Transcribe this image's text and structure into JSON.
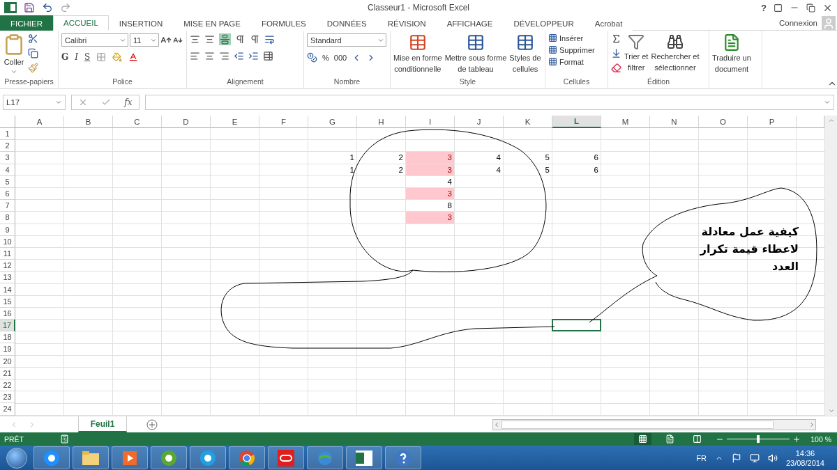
{
  "title_bar": {
    "title": "Classeur1 - Microsoft Excel",
    "help": "?"
  },
  "ribbon_tabs": [
    {
      "label": "FICHIER",
      "kind": "file",
      "selected": false
    },
    {
      "label": "ACCUEIL",
      "kind": "tab",
      "selected": true
    },
    {
      "label": "INSERTION",
      "kind": "tab",
      "selected": false
    },
    {
      "label": "MISE EN PAGE",
      "kind": "tab",
      "selected": false
    },
    {
      "label": "FORMULES",
      "kind": "tab",
      "selected": false
    },
    {
      "label": "DONNÉES",
      "kind": "tab",
      "selected": false
    },
    {
      "label": "RÉVISION",
      "kind": "tab",
      "selected": false
    },
    {
      "label": "AFFICHAGE",
      "kind": "tab",
      "selected": false
    },
    {
      "label": "DÉVELOPPEUR",
      "kind": "tab",
      "selected": false
    },
    {
      "label": "Acrobat",
      "kind": "tab",
      "selected": false
    }
  ],
  "account": "Connexion",
  "ribbon": {
    "clipboard": {
      "title": "Presse-papiers",
      "paste": "Coller"
    },
    "font": {
      "title": "Police",
      "font_name": "Calibri",
      "font_size": "11",
      "bold": "G",
      "italic": "I",
      "underline": "S"
    },
    "alignment": {
      "title": "Alignement"
    },
    "number": {
      "title": "Nombre",
      "format": "Standard",
      "percent": "%",
      "thousands": "000"
    },
    "style": {
      "title": "Style",
      "buttons": [
        {
          "lines": [
            "Mise en forme",
            "conditionnelle"
          ]
        },
        {
          "lines": [
            "Mettre sous forme",
            "de tableau"
          ]
        },
        {
          "lines": [
            "Styles de",
            "cellules"
          ]
        }
      ]
    },
    "cells": {
      "title": "Cellules",
      "buttons": [
        "Insérer",
        "Supprimer",
        "Format"
      ]
    },
    "editing": {
      "title": "Édition",
      "buttons": [
        {
          "lines": [
            "Trier et",
            "filtrer"
          ]
        },
        {
          "lines": [
            "Rechercher et",
            "sélectionner"
          ]
        }
      ]
    },
    "acrobat": {
      "buttons": [
        {
          "lines": [
            "Traduire un",
            "document"
          ]
        }
      ]
    }
  },
  "formula_bar": {
    "name_box": "L17",
    "function_label": "fx"
  },
  "sheet": {
    "columns": [
      {
        "label": "A",
        "selected": false
      },
      {
        "label": "B",
        "selected": false
      },
      {
        "label": "C",
        "selected": false
      },
      {
        "label": "D",
        "selected": false
      },
      {
        "label": "E",
        "selected": false
      },
      {
        "label": "F",
        "selected": false
      },
      {
        "label": "G",
        "selected": false
      },
      {
        "label": "H",
        "selected": false
      },
      {
        "label": "I",
        "selected": false
      },
      {
        "label": "J",
        "selected": false
      },
      {
        "label": "K",
        "selected": false
      },
      {
        "label": "L",
        "selected": true
      },
      {
        "label": "M",
        "selected": false
      },
      {
        "label": "N",
        "selected": false
      },
      {
        "label": "O",
        "selected": false
      },
      {
        "label": "P",
        "selected": false
      }
    ],
    "rows": [
      {
        "label": "1",
        "selected": false
      },
      {
        "label": "2",
        "selected": false
      },
      {
        "label": "3",
        "selected": false,
        "cells": {
          "G": {
            "value": "1",
            "highlight": false,
            "selected": false
          },
          "H": {
            "value": "2",
            "highlight": false,
            "selected": false
          },
          "I": {
            "value": "3",
            "highlight": true,
            "selected": false
          },
          "J": {
            "value": "4",
            "highlight": false,
            "selected": false
          },
          "K": {
            "value": "5",
            "highlight": false,
            "selected": false
          },
          "L": {
            "value": "6",
            "highlight": false,
            "selected": false
          }
        }
      },
      {
        "label": "4",
        "selected": false,
        "cells": {
          "G": {
            "value": "1",
            "highlight": false,
            "selected": false
          },
          "H": {
            "value": "2",
            "highlight": false,
            "selected": false
          },
          "I": {
            "value": "3",
            "highlight": true,
            "selected": false
          },
          "J": {
            "value": "4",
            "highlight": false,
            "selected": false
          },
          "K": {
            "value": "5",
            "highlight": false,
            "selected": false
          },
          "L": {
            "value": "6",
            "highlight": false,
            "selected": false
          }
        }
      },
      {
        "label": "5",
        "selected": false,
        "cells": {
          "I": {
            "value": "4",
            "highlight": false,
            "selected": false
          }
        }
      },
      {
        "label": "6",
        "selected": false,
        "cells": {
          "I": {
            "value": "3",
            "highlight": true,
            "selected": false
          }
        }
      },
      {
        "label": "7",
        "selected": false,
        "cells": {
          "I": {
            "value": "8",
            "highlight": false,
            "selected": false
          }
        }
      },
      {
        "label": "8",
        "selected": false,
        "cells": {
          "I": {
            "value": "3",
            "highlight": true,
            "selected": false
          }
        }
      },
      {
        "label": "9",
        "selected": false
      },
      {
        "label": "10",
        "selected": false
      },
      {
        "label": "11",
        "selected": false
      },
      {
        "label": "12",
        "selected": false
      },
      {
        "label": "13",
        "selected": false
      },
      {
        "label": "14",
        "selected": false
      },
      {
        "label": "15",
        "selected": false
      },
      {
        "label": "16",
        "selected": false
      },
      {
        "label": "17",
        "selected": true,
        "cells": {
          "L": {
            "highlight": false,
            "selected": true
          }
        }
      },
      {
        "label": "18",
        "selected": false
      },
      {
        "label": "19",
        "selected": false
      },
      {
        "label": "20",
        "selected": false
      },
      {
        "label": "21",
        "selected": false
      },
      {
        "label": "22",
        "selected": false
      },
      {
        "label": "23",
        "selected": false
      },
      {
        "label": "24",
        "selected": false
      }
    ],
    "annotation": {
      "lines": [
        "كيفية عمل معادلة",
        "لاعطاء قيمة تكرار",
        "العدد"
      ]
    }
  },
  "sheet_tabs": [
    {
      "label": "Feuil1",
      "selected": true
    }
  ],
  "status_bar": {
    "status": "PRÊT",
    "zoom": {
      "level": 0.5,
      "reading": "100 %"
    }
  },
  "taskbar": {
    "language": "FR",
    "time": "14:36",
    "date": "23/08/2014"
  }
}
